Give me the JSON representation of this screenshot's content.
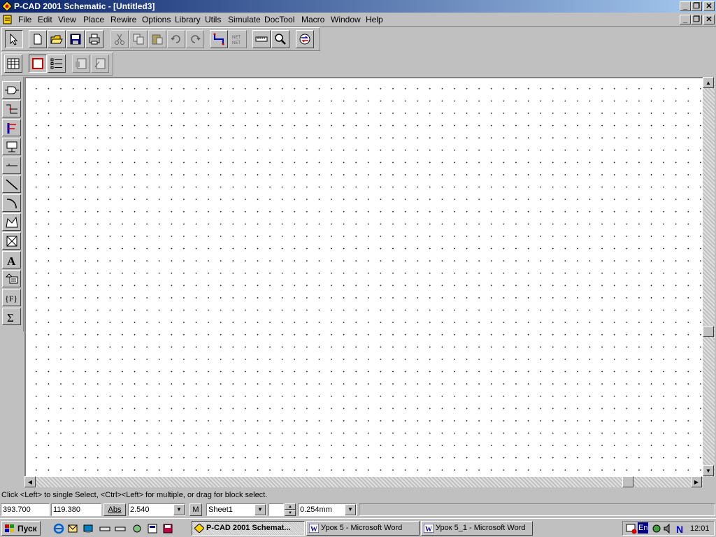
{
  "window": {
    "title": "P-CAD 2001 Schematic - [Untitled3]"
  },
  "menu": {
    "items": [
      "File",
      "Edit",
      "View",
      "Place",
      "Rewire",
      "Options",
      "Library",
      "Utils",
      "Simulate",
      "DocTool",
      "Macro",
      "Window",
      "Help"
    ]
  },
  "toolbar": {
    "top_icons": [
      "select-arrow-icon",
      "new-file-icon",
      "open-folder-icon",
      "save-icon",
      "print-icon",
      "cut-icon",
      "copy-icon",
      "paste-icon",
      "undo-icon",
      "redo-icon",
      "wire-icon",
      "netlist-icon",
      "ruler-icon",
      "zoom-icon",
      "switch-icon"
    ],
    "second_icons": [
      "table-icon",
      "sheet-icon",
      "list-icon",
      "report-icon",
      "report2-icon"
    ]
  },
  "left_tools": [
    "place-part-icon",
    "place-wire-icon",
    "place-bus-icon",
    "place-port-icon",
    "place-pin-icon",
    "place-line-icon",
    "place-arc-icon",
    "place-polygon-icon",
    "place-field-icon",
    "place-text-icon",
    "place-attribute-icon",
    "place-function-icon",
    "place-sum-icon"
  ],
  "status": {
    "message": "Click <Left> to single Select, <Ctrl><Left> for multiple, or drag for block select.",
    "x_coord": "393.700",
    "y_coord": "119.380",
    "abs_label": "Abs",
    "grid": "2.540",
    "m_label": "M",
    "sheet": "Sheet1",
    "line_width": "0.254mm"
  },
  "taskbar": {
    "start_label": "Пуск",
    "tasks": [
      "P-CAD 2001 Schemat...",
      "Урок 5 - Microsoft Word",
      "Урок 5_1 - Microsoft Word"
    ],
    "lang": "En",
    "time": "12:01"
  }
}
